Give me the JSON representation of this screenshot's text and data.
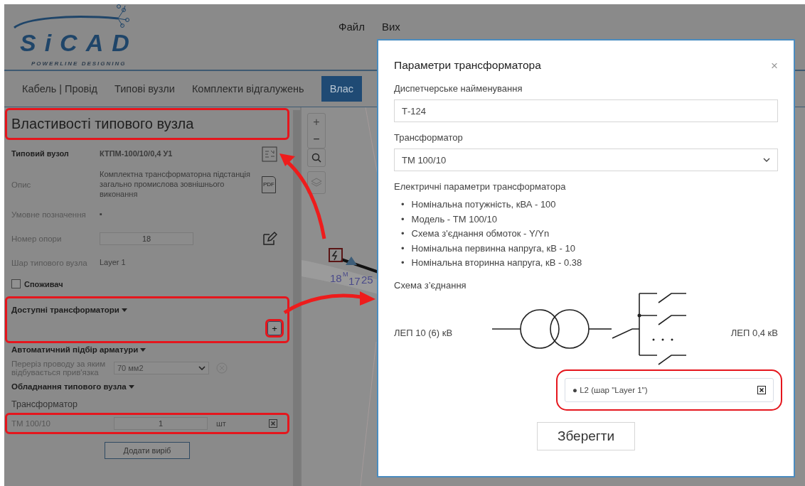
{
  "header": {
    "logo_text": "SiCAD",
    "logo_tagline": "POWERLINE DESIGNING",
    "menu": [
      "Файл",
      "Вих"
    ]
  },
  "tabs": [
    {
      "label": "Кабель | Провід",
      "selected": false
    },
    {
      "label": "Типові вузли",
      "selected": false
    },
    {
      "label": "Комплекти відгалужень",
      "selected": false
    },
    {
      "label": "Влас",
      "selected": true
    }
  ],
  "panel": {
    "title": "Властивості типового вузла",
    "title_highlighted": true,
    "properties": [
      {
        "kind": "bold",
        "label": "Типовий вузол",
        "value": "КТПМ-100/10/0,4 У1"
      },
      {
        "kind": "text",
        "label": "Опис",
        "value": "Комплектна трансформаторна підстанція загально промислова зовнішнього виконання",
        "icon_label": "PDF"
      },
      {
        "kind": "text",
        "label": "Умовне позначення",
        "value": "▪"
      },
      {
        "kind": "input",
        "label": "Номер опори",
        "value": "18"
      },
      {
        "kind": "text",
        "label": "Шар типового вузла",
        "value": "Layer 1"
      }
    ],
    "consumer": {
      "label": "Споживач",
      "checked": false
    },
    "available": {
      "title": "Доступні трансформатори",
      "expanded": true,
      "highlighted": true,
      "add_label": "+",
      "add_highlighted": true
    },
    "auto": {
      "title": "Автоматичний підбір арматури",
      "expanded": true,
      "label": "Переріз проводу за яким відбувається прив'язка",
      "value": "70 мм2"
    },
    "equipment": {
      "title": "Обладнання типового вузла",
      "expanded": true,
      "group": "Трансформатор",
      "items": [
        {
          "name": "ТМ 100/10",
          "quantity": "1",
          "unit": "шт",
          "highlighted": true
        }
      ],
      "add_button": "Додати виріб"
    }
  },
  "map": {
    "zoom_in": "+",
    "zoom_out": "−",
    "labels": [
      "18",
      "М",
      "17",
      "25"
    ]
  },
  "dialog": {
    "title": "Параметри трансформатора",
    "close": "×",
    "name_label": "Диспетчерське найменування",
    "name_value": "Т-124",
    "transformer_label": "Трансформатор",
    "transformer_value": "ТМ 100/10",
    "params_title": "Електричні параметри трансформатора",
    "bullet": "•",
    "params": [
      "Номінальна потужність, кВА - 100",
      "Модель - ТМ 100/10",
      "Схема з'єднання обмоток - Y/Yn",
      "Номінальна первинна напруга, кВ - 10",
      "Номінальна вторинна напруга, кВ - 0.38"
    ],
    "scheme_title": "Схема з’єднання",
    "left_label": "ЛЕП 10 (6) кВ",
    "right_label": "ЛЕП 0,4 кВ",
    "lines": [
      {
        "bullet": "●",
        "label": "L2 (шар \"Layer 1\")",
        "highlighted": true
      }
    ],
    "save": "Зберегти"
  }
}
